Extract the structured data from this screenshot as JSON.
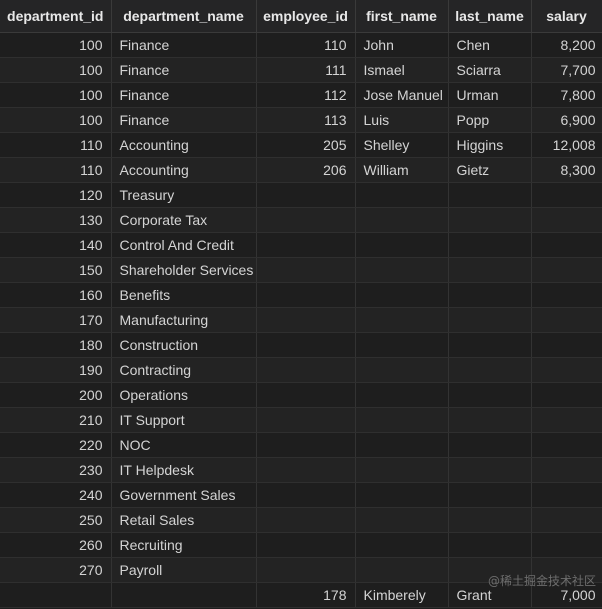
{
  "columns": [
    "department_id",
    "department_name",
    "employee_id",
    "first_name",
    "last_name",
    "salary"
  ],
  "rows": [
    [
      "100",
      "Finance",
      "110",
      "John",
      "Chen",
      "8,200"
    ],
    [
      "100",
      "Finance",
      "111",
      "Ismael",
      "Sciarra",
      "7,700"
    ],
    [
      "100",
      "Finance",
      "112",
      "Jose Manuel",
      "Urman",
      "7,800"
    ],
    [
      "100",
      "Finance",
      "113",
      "Luis",
      "Popp",
      "6,900"
    ],
    [
      "110",
      "Accounting",
      "205",
      "Shelley",
      "Higgins",
      "12,008"
    ],
    [
      "110",
      "Accounting",
      "206",
      "William",
      "Gietz",
      "8,300"
    ],
    [
      "120",
      "Treasury",
      "",
      "",
      "",
      ""
    ],
    [
      "130",
      "Corporate Tax",
      "",
      "",
      "",
      ""
    ],
    [
      "140",
      "Control And Credit",
      "",
      "",
      "",
      ""
    ],
    [
      "150",
      "Shareholder Services",
      "",
      "",
      "",
      ""
    ],
    [
      "160",
      "Benefits",
      "",
      "",
      "",
      ""
    ],
    [
      "170",
      "Manufacturing",
      "",
      "",
      "",
      ""
    ],
    [
      "180",
      "Construction",
      "",
      "",
      "",
      ""
    ],
    [
      "190",
      "Contracting",
      "",
      "",
      "",
      ""
    ],
    [
      "200",
      "Operations",
      "",
      "",
      "",
      ""
    ],
    [
      "210",
      "IT Support",
      "",
      "",
      "",
      ""
    ],
    [
      "220",
      "NOC",
      "",
      "",
      "",
      ""
    ],
    [
      "230",
      "IT Helpdesk",
      "",
      "",
      "",
      ""
    ],
    [
      "240",
      "Government Sales",
      "",
      "",
      "",
      ""
    ],
    [
      "250",
      "Retail Sales",
      "",
      "",
      "",
      ""
    ],
    [
      "260",
      "Recruiting",
      "",
      "",
      "",
      ""
    ],
    [
      "270",
      "Payroll",
      "",
      "",
      "",
      ""
    ],
    [
      "",
      "",
      "178",
      "Kimberely",
      "Grant",
      "7,000"
    ]
  ],
  "watermark": "@稀土掘金技术社区"
}
